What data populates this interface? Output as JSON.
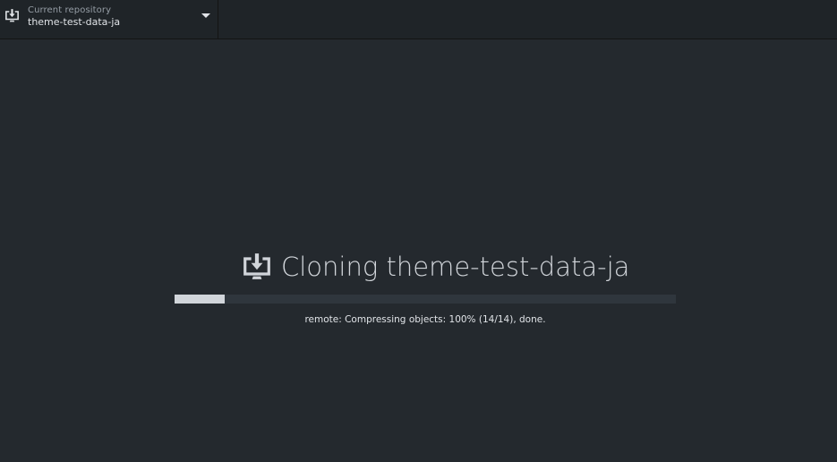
{
  "toolbar": {
    "repository": {
      "caption": "Current repository",
      "name": "theme-test-data-ja",
      "icon": "clone-icon"
    },
    "dropdown_icon": "chevron-down-icon"
  },
  "clone": {
    "icon": "clone-icon",
    "title": "Cloning theme-test-data-ja",
    "progress_fraction": 0.1,
    "status": "remote: Compressing objects: 100% (14/14), done."
  },
  "colors": {
    "background": "#24292e",
    "toolbar": "#1f2428",
    "progress_track": "#2f363d",
    "progress_fill": "#d1d5da"
  }
}
